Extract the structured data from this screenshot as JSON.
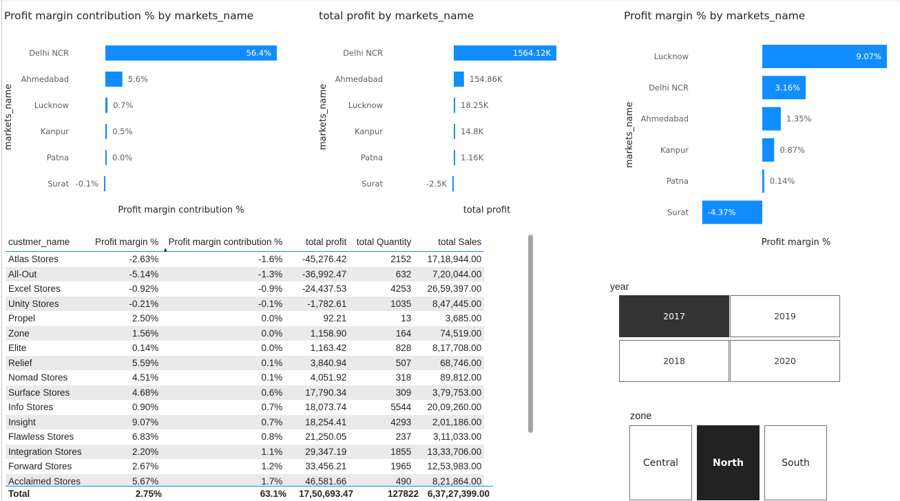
{
  "charts": [
    {
      "id": "chart1",
      "title": "Profit margin contribution % by markets_name",
      "chart_data": {
        "type": "bar",
        "orientation": "horizontal",
        "title": "Profit margin contribution % by markets_name",
        "xlabel": "Profit margin contribution %",
        "ylabel": "markets_name",
        "categories": [
          "Delhi NCR",
          "Ahmedabad",
          "Lucknow",
          "Kanpur",
          "Patna",
          "Surat"
        ],
        "values": [
          56.4,
          5.6,
          0.7,
          0.5,
          0.0,
          -0.1
        ],
        "labels": [
          "56.4%",
          "5.6%",
          "0.7%",
          "0.5%",
          "0.0%",
          "-0.1%"
        ],
        "grid": false,
        "bar_color": "#118dff"
      }
    },
    {
      "id": "chart2",
      "title": "total profit by markets_name",
      "chart_data": {
        "type": "bar",
        "orientation": "horizontal",
        "title": "total profit by markets_name",
        "xlabel": "total profit",
        "ylabel": "markets_name",
        "categories": [
          "Delhi NCR",
          "Ahmedabad",
          "Lucknow",
          "Kanpur",
          "Patna",
          "Surat"
        ],
        "values": [
          1564120,
          154860,
          18250,
          14800,
          1160,
          -2500
        ],
        "labels": [
          "1564.12K",
          "154.86K",
          "18.25K",
          "14.8K",
          "1.16K",
          "-2.5K"
        ],
        "grid": false,
        "bar_color": "#118dff"
      }
    },
    {
      "id": "chart3",
      "title": "Profit margin % by markets_name",
      "chart_data": {
        "type": "bar",
        "orientation": "horizontal",
        "title": "Profit margin % by markets_name",
        "xlabel": "Profit margin %",
        "ylabel": "markets_name",
        "categories": [
          "Lucknow",
          "Delhi NCR",
          "Ahmedabad",
          "Kanpur",
          "Patna",
          "Surat"
        ],
        "values": [
          9.07,
          3.16,
          1.35,
          0.87,
          0.14,
          -4.37
        ],
        "labels": [
          "9.07%",
          "3.16%",
          "1.35%",
          "0.87%",
          "0.14%",
          "-4.37%"
        ],
        "grid": false,
        "bar_color": "#118dff"
      }
    }
  ],
  "table": {
    "columns": [
      "custmer_name",
      "Profit margin %",
      "Profit margin contribution %",
      "total profit",
      "total Quantity",
      "total Sales"
    ],
    "rows": [
      [
        "Atlas Stores",
        "-2.63%",
        "-1.6%",
        "-45,276.42",
        "2152",
        "17,18,944.00"
      ],
      [
        "All-Out",
        "-5.14%",
        "-1.3%",
        "-36,992.47",
        "632",
        "7,20,044.00"
      ],
      [
        "Excel Stores",
        "-0.92%",
        "-0.9%",
        "-24,437.53",
        "4253",
        "26,59,397.00"
      ],
      [
        "Unity Stores",
        "-0.21%",
        "-0.1%",
        "-1,782.61",
        "1035",
        "8,47,445.00"
      ],
      [
        "Propel",
        "2.50%",
        "0.0%",
        "92.21",
        "13",
        "3,685.00"
      ],
      [
        "Zone",
        "1.56%",
        "0.0%",
        "1,158.90",
        "164",
        "74,519.00"
      ],
      [
        "Elite",
        "0.14%",
        "0.0%",
        "1,163.42",
        "828",
        "8,17,708.00"
      ],
      [
        "Relief",
        "5.59%",
        "0.1%",
        "3,840.94",
        "507",
        "68,746.00"
      ],
      [
        "Nomad Stores",
        "4.51%",
        "0.1%",
        "4,051.92",
        "318",
        "89,812.00"
      ],
      [
        "Surface Stores",
        "4.68%",
        "0.6%",
        "17,790.34",
        "309",
        "3,79,753.00"
      ],
      [
        "Info Stores",
        "0.90%",
        "0.7%",
        "18,073.74",
        "5544",
        "20,09,260.00"
      ],
      [
        "Insight",
        "9.07%",
        "0.7%",
        "18,254.41",
        "4293",
        "2,01,186.00"
      ],
      [
        "Flawless Stores",
        "6.83%",
        "0.8%",
        "21,250.05",
        "237",
        "3,11,033.00"
      ],
      [
        "Integration Stores",
        "2.20%",
        "1.1%",
        "29,347.19",
        "1855",
        "13,33,706.00"
      ],
      [
        "Forward Stores",
        "2.67%",
        "1.2%",
        "33,456.21",
        "1965",
        "12,53,983.00"
      ],
      [
        "Acclaimed Stores",
        "5.67%",
        "1.7%",
        "46,581.66",
        "490",
        "8,21,864.00"
      ]
    ],
    "total": {
      "label": "Total",
      "profit_margin": "2.75%",
      "contribution": "63.1%",
      "total_profit": "17,50,693.47",
      "total_quantity": "127822",
      "total_sales": "6,37,27,399.00"
    }
  },
  "year_slicer": {
    "title": "year",
    "options": [
      "2017",
      "2019",
      "2018",
      "2020"
    ],
    "selected": "2017"
  },
  "zone_slicer": {
    "title": "zone",
    "options": [
      "Central",
      "North",
      "South"
    ],
    "selected": "North"
  }
}
